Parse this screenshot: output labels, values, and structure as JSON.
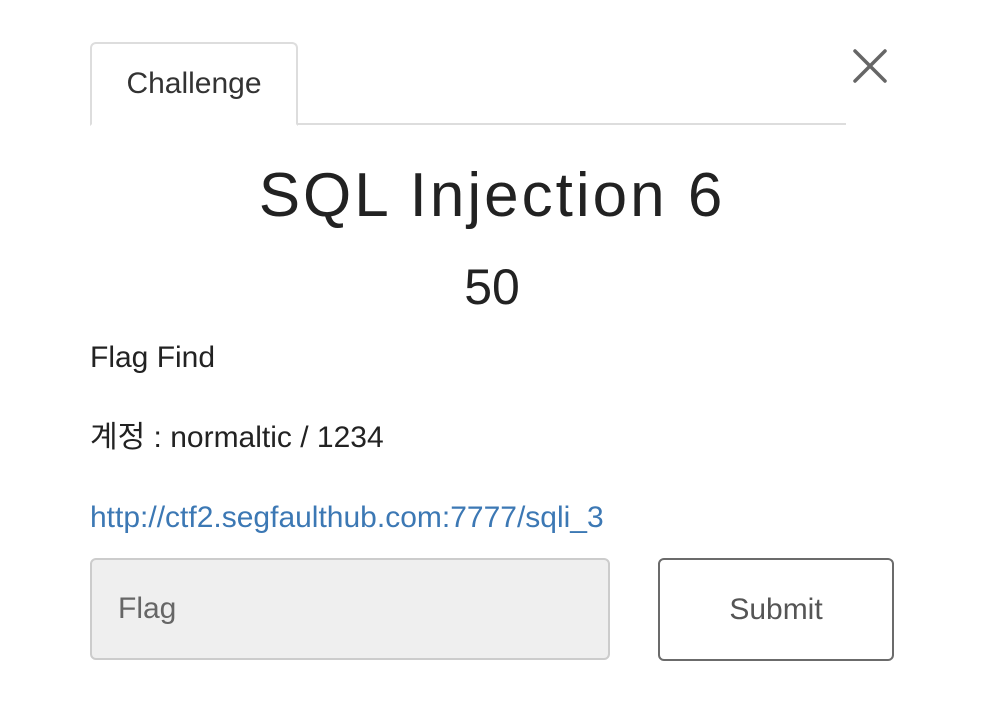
{
  "tabs": [
    {
      "label": "Challenge",
      "active": true
    }
  ],
  "close_icon": "close-icon",
  "challenge": {
    "name": "SQL Injection 6",
    "points": "50",
    "description": [
      "Flag Find",
      "계정 : normaltic / 1234"
    ],
    "link": "http://ctf2.segfaulthub.com:7777/sqli_3"
  },
  "form": {
    "flag_placeholder": "Flag",
    "flag_value": "",
    "submit_label": "Submit"
  }
}
